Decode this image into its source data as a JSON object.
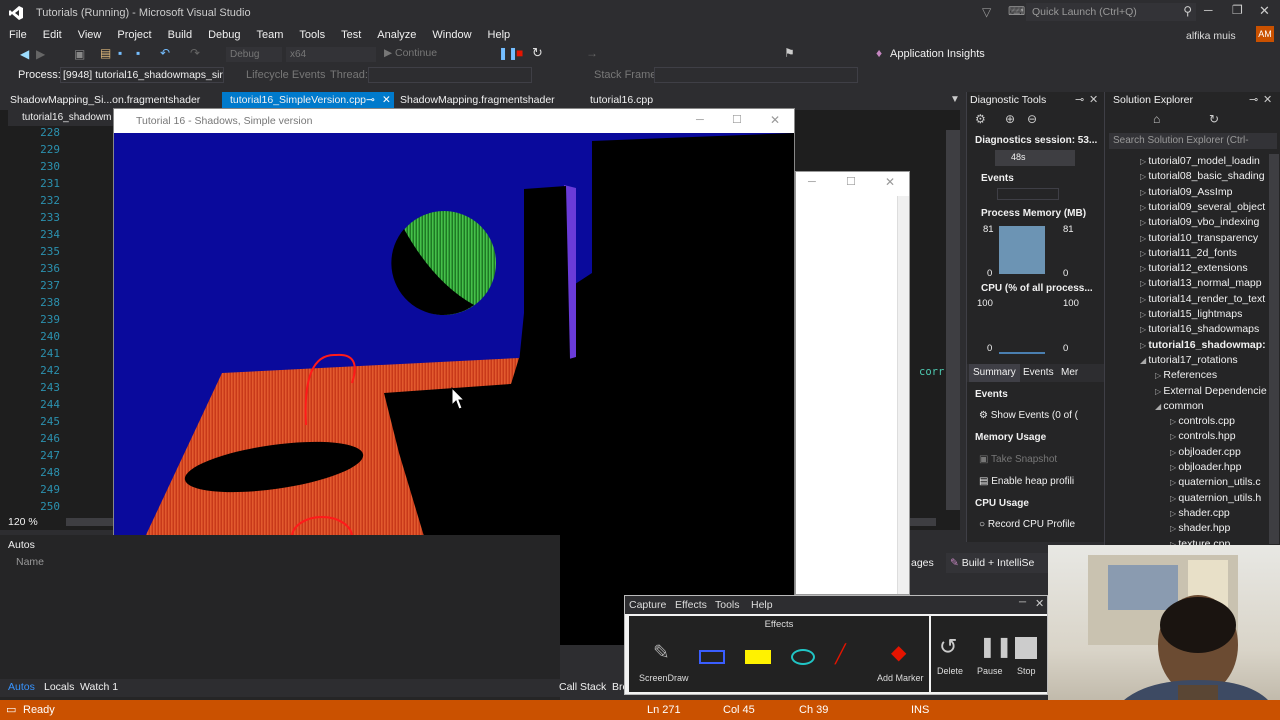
{
  "window": {
    "title": "Tutorials (Running) - Microsoft Visual Studio",
    "quick_launch": "Quick Launch (Ctrl+Q)",
    "user": "alfika muis",
    "user_initials": "AM"
  },
  "menu": [
    "File",
    "Edit",
    "View",
    "Project",
    "Build",
    "Debug",
    "Team",
    "Tools",
    "Test",
    "Analyze",
    "Window",
    "Help"
  ],
  "toolbar": {
    "config": "Debug",
    "platform": "x64",
    "continue_label": "Continue",
    "app_insights": "Application Insights"
  },
  "process_bar": {
    "process_label": "Process:",
    "process_value": "[9948] tutorial16_shadowmaps_sir",
    "lifecycle_label": "Lifecycle Events",
    "thread_label": "Thread:",
    "stack_frame_label": "Stack Frame:"
  },
  "tabs": [
    {
      "label": "ShadowMapping_Si...on.fragmentshader",
      "active": false
    },
    {
      "label": "tutorial16_SimpleVersion.cpp",
      "active": true
    },
    {
      "label": "ShadowMapping.fragmentshader",
      "active": false
    },
    {
      "label": "tutorial16.cpp",
      "active": false
    }
  ],
  "editor": {
    "nav_left": "tutorial16_shadowm",
    "line_numbers": [
      "228",
      "229",
      "230",
      "231",
      "232",
      "233",
      "234",
      "235",
      "236",
      "237",
      "238",
      "239",
      "240",
      "241",
      "242",
      "243",
      "244",
      "245",
      "246",
      "247",
      "248",
      "249",
      "250"
    ],
    "zoom": "120 %",
    "fragment": "corr"
  },
  "game_window": {
    "title": "Tutorial 16 - Shadows, Simple version"
  },
  "diagnostic_tools": {
    "title": "Diagnostic Tools",
    "session": "Diagnostics session: 53...",
    "time": "48s",
    "events_header": "Events",
    "memory_header": "Process Memory (MB)",
    "mem_max_left": "81",
    "mem_max_right": "81",
    "mem_min_left": "0",
    "mem_min_right": "0",
    "cpu_header": "CPU (% of all process...",
    "cpu_max_left": "100",
    "cpu_max_right": "100",
    "cpu_min_left": "0",
    "cpu_min_right": "0",
    "subtabs": [
      "Summary",
      "Events",
      "Mer"
    ],
    "events_section": "Events",
    "show_events": "Show Events (0 of (",
    "memory_usage": "Memory Usage",
    "take_snapshot": "Take Snapshot",
    "enable_heap": "Enable heap profili",
    "cpu_usage": "CPU Usage",
    "record_cpu": "Record CPU Profile"
  },
  "solution_explorer": {
    "title": "Solution Explorer",
    "search_placeholder": "Search Solution Explorer (Ctrl-",
    "items": [
      {
        "label": "tutorial07_model_loadin",
        "bold": false,
        "depth": 0
      },
      {
        "label": "tutorial08_basic_shading",
        "bold": false,
        "depth": 0
      },
      {
        "label": "tutorial09_AssImp",
        "bold": false,
        "depth": 0
      },
      {
        "label": "tutorial09_several_object",
        "bold": false,
        "depth": 0
      },
      {
        "label": "tutorial09_vbo_indexing",
        "bold": false,
        "depth": 0
      },
      {
        "label": "tutorial10_transparency",
        "bold": false,
        "depth": 0
      },
      {
        "label": "tutorial11_2d_fonts",
        "bold": false,
        "depth": 0
      },
      {
        "label": "tutorial12_extensions",
        "bold": false,
        "depth": 0
      },
      {
        "label": "tutorial13_normal_mapp",
        "bold": false,
        "depth": 0
      },
      {
        "label": "tutorial14_render_to_text",
        "bold": false,
        "depth": 0
      },
      {
        "label": "tutorial15_lightmaps",
        "bold": false,
        "depth": 0
      },
      {
        "label": "tutorial16_shadowmaps",
        "bold": false,
        "depth": 0
      },
      {
        "label": "tutorial16_shadowmap:",
        "bold": true,
        "depth": 0
      },
      {
        "label": "tutorial17_rotations",
        "bold": false,
        "depth": 0
      },
      {
        "label": "References",
        "bold": false,
        "depth": 1
      },
      {
        "label": "External Dependencie",
        "bold": false,
        "depth": 1
      },
      {
        "label": "common",
        "bold": false,
        "depth": 1
      },
      {
        "label": "controls.cpp",
        "bold": false,
        "depth": 2
      },
      {
        "label": "controls.hpp",
        "bold": false,
        "depth": 2
      },
      {
        "label": "objloader.cpp",
        "bold": false,
        "depth": 2
      },
      {
        "label": "objloader.hpp",
        "bold": false,
        "depth": 2
      },
      {
        "label": "quaternion_utils.c",
        "bold": false,
        "depth": 2
      },
      {
        "label": "quaternion_utils.h",
        "bold": false,
        "depth": 2
      },
      {
        "label": "shader.cpp",
        "bold": false,
        "depth": 2
      },
      {
        "label": "shader.hpp",
        "bold": false,
        "depth": 2
      },
      {
        "label": "texture.cpp",
        "bold": false,
        "depth": 2
      }
    ]
  },
  "autos": {
    "title": "Autos",
    "name_col": "Name"
  },
  "bottom_tabs": [
    "Autos",
    "Locals",
    "Watch 1"
  ],
  "bottom_right_tabs": [
    "Call Stack",
    "Bre"
  ],
  "output_fragments": {
    "ages": "ages",
    "build_filter": "Build + IntelliSe"
  },
  "capture_tool": {
    "menu": [
      "Capture",
      "Effects",
      "Tools",
      "Help"
    ],
    "section": "Effects",
    "tools": [
      "ScreenDraw"
    ],
    "actions": [
      "Add Marker",
      "Delete",
      "Pause",
      "Stop"
    ]
  },
  "status": {
    "state": "Ready",
    "ln": "Ln 271",
    "col": "Col 45",
    "ch": "Ch 39",
    "mode": "INS"
  },
  "colors": {
    "accent": "#007acc",
    "status": "#ca5100",
    "floor": "#d8431e",
    "sky": "#0a0a9c",
    "sphere": "#2fae35"
  }
}
